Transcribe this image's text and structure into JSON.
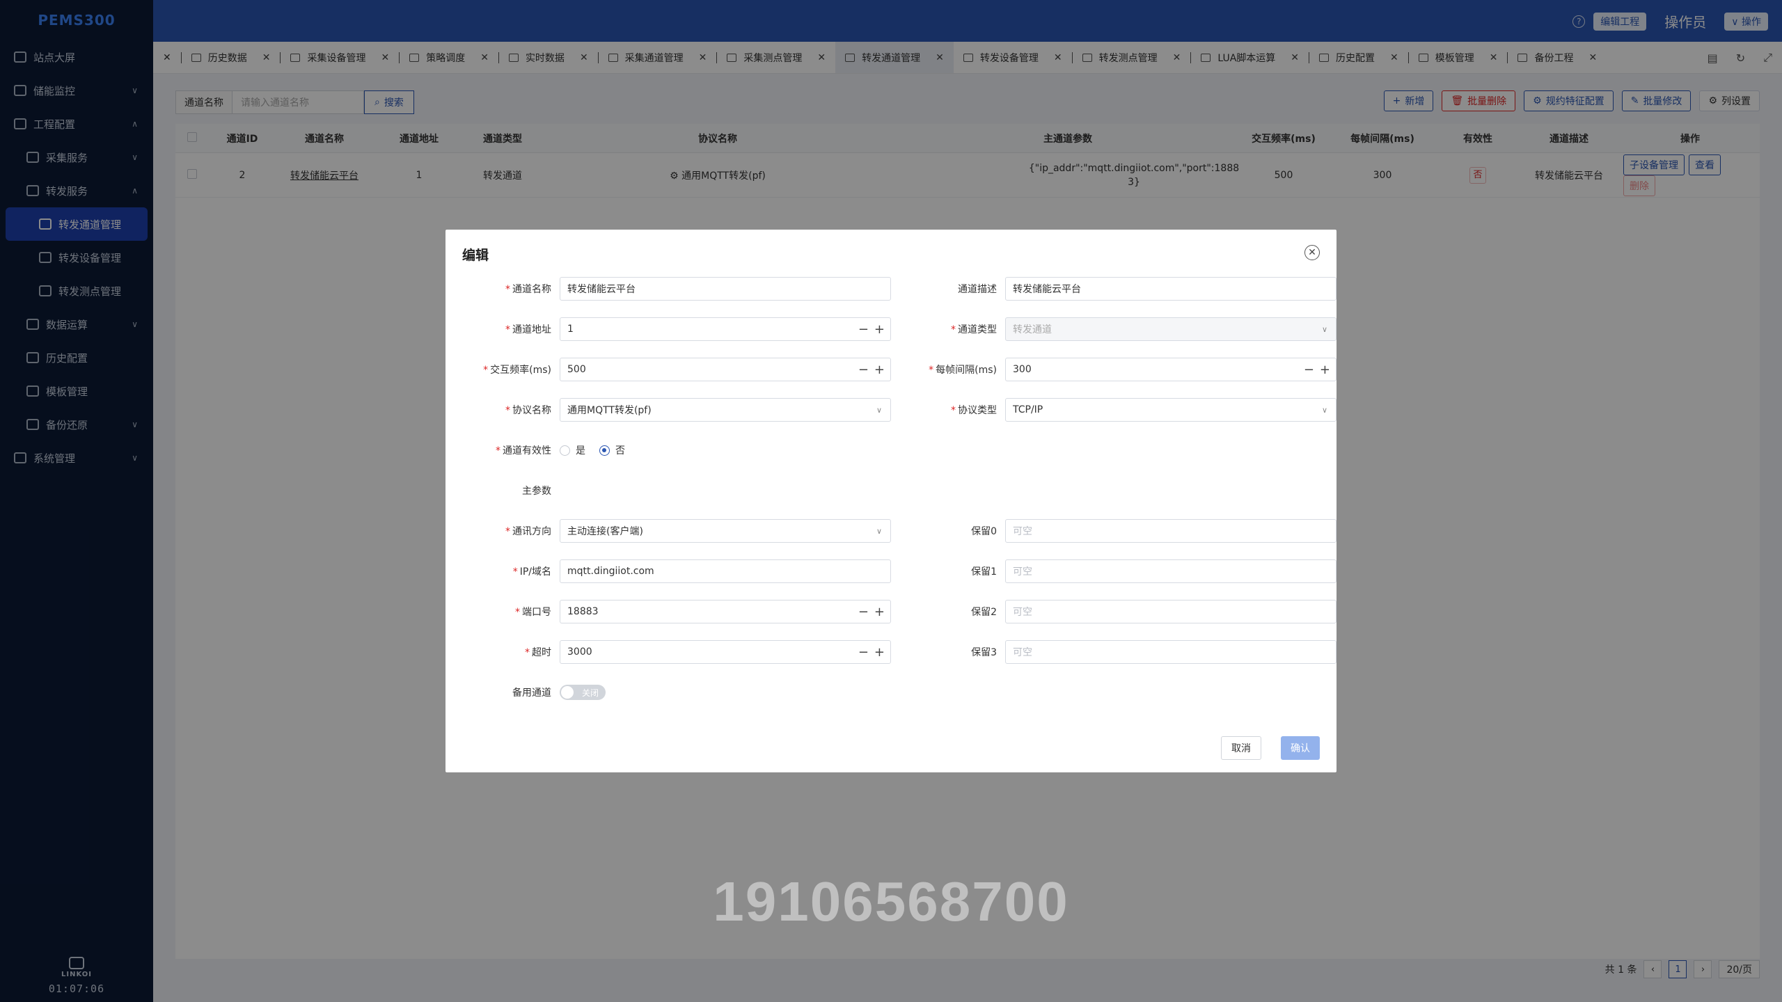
{
  "app": {
    "brand": "PEMS300",
    "footer_logo": "LINKOI",
    "clock": "01:07:06"
  },
  "sidebar": {
    "items": [
      {
        "label": "站点大屏"
      },
      {
        "label": "储能监控"
      },
      {
        "label": "工程配置"
      },
      {
        "label": "采集服务"
      },
      {
        "label": "转发服务"
      },
      {
        "label": "转发通道管理"
      },
      {
        "label": "转发设备管理"
      },
      {
        "label": "转发测点管理"
      },
      {
        "label": "数据运算"
      },
      {
        "label": "历史配置"
      },
      {
        "label": "模板管理"
      },
      {
        "label": "备份还原"
      },
      {
        "label": "系统管理"
      }
    ]
  },
  "topbar": {
    "edit_project": "编辑工程",
    "user": "操作员",
    "operation": "操作"
  },
  "tabs": [
    {
      "label": "历史数据"
    },
    {
      "label": "采集设备管理"
    },
    {
      "label": "策略调度"
    },
    {
      "label": "实时数据"
    },
    {
      "label": "采集通道管理"
    },
    {
      "label": "采集测点管理"
    },
    {
      "label": "转发通道管理"
    },
    {
      "label": "转发设备管理"
    },
    {
      "label": "转发测点管理"
    },
    {
      "label": "LUA脚本运算"
    },
    {
      "label": "历史配置"
    },
    {
      "label": "模板管理"
    },
    {
      "label": "备份工程"
    }
  ],
  "filter": {
    "label": "通道名称",
    "placeholder": "请输入通道名称",
    "search": "搜索"
  },
  "actions": {
    "add": "新增",
    "batch_delete": "批量删除",
    "protocol_config": "规约特征配置",
    "batch_edit": "批量修改",
    "column_settings": "列设置"
  },
  "table": {
    "headers": [
      "通道ID",
      "通道名称",
      "通道地址",
      "通道类型",
      "协议名称",
      "主通道参数",
      "交互频率(ms)",
      "每帧间隔(ms)",
      "有效性",
      "通道描述",
      "操作"
    ],
    "rows": [
      {
        "id": "2",
        "name": "转发储能云平台",
        "address": "1",
        "type": "转发通道",
        "protocol": "通用MQTT转发(pf)",
        "params_line1": "{\"ip_addr\":\"mqtt.dingiiot.com\",\"port\":1888",
        "params_line2": "3}",
        "freq": "500",
        "interval": "300",
        "valid": "否",
        "desc": "转发储能云平台",
        "op_sub": "子设备管理",
        "op_view": "查看",
        "op_delete": "删除"
      }
    ]
  },
  "pager": {
    "total": "共 1 条",
    "page": "1",
    "size": "20/页"
  },
  "modal": {
    "title": "编辑",
    "fields": {
      "name_label": "通道名称",
      "name_value": "转发储能云平台",
      "desc_label": "通道描述",
      "desc_value": "转发储能云平台",
      "addr_label": "通道地址",
      "addr_value": "1",
      "type_label": "通道类型",
      "type_value": "转发通道",
      "freq_label": "交互频率(ms)",
      "freq_value": "500",
      "interval_label": "每帧间隔(ms)",
      "interval_value": "300",
      "protocol_label": "协议名称",
      "protocol_value": "通用MQTT转发(pf)",
      "proto_type_label": "协议类型",
      "proto_type_value": "TCP/IP",
      "valid_label": "通道有效性",
      "valid_yes": "是",
      "valid_no": "否",
      "main_params": "主参数",
      "direction_label": "通讯方向",
      "direction_value": "主动连接(客户端)",
      "ip_label": "IP/域名",
      "ip_value": "mqtt.dingiiot.com",
      "port_label": "端口号",
      "port_value": "18883",
      "timeout_label": "超时",
      "timeout_value": "3000",
      "reserve0_label": "保留0",
      "reserve1_label": "保留1",
      "reserve2_label": "保留2",
      "reserve3_label": "保留3",
      "reserve_placeholder": "可空",
      "backup_label": "备用通道",
      "backup_state": "关闭"
    },
    "cancel": "取消",
    "confirm": "确认"
  },
  "watermark": "19106568700"
}
